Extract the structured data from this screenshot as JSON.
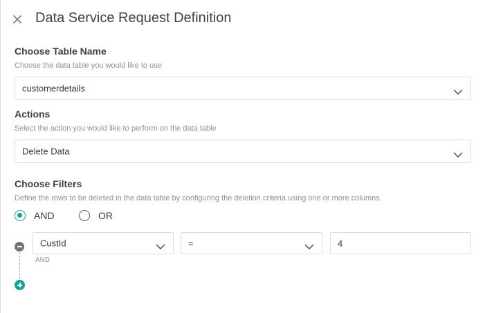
{
  "header": {
    "title": "Data Service Request Definition",
    "close_icon": "close-icon"
  },
  "table_section": {
    "title": "Choose Table Name",
    "description": "Choose the data table you would like to use",
    "selected": "customerdetails"
  },
  "actions_section": {
    "title": "Actions",
    "description": "Select the action you would like to perform on the data table",
    "selected": "Delete Data"
  },
  "filters_section": {
    "title": "Choose Filters",
    "description": "Define the rows to be deleted in the data table by configuring the deletion criteria using one or more columns.",
    "logic_options": [
      {
        "label": "AND",
        "checked": true
      },
      {
        "label": "OR",
        "checked": false
      }
    ],
    "filter_row": {
      "column": "CustId",
      "operator": "=",
      "value": "4",
      "join_label": "AND"
    }
  },
  "colors": {
    "accent": "#12a39a",
    "border": "#dadde2",
    "text": "#333a44",
    "muted": "#8a9099"
  }
}
